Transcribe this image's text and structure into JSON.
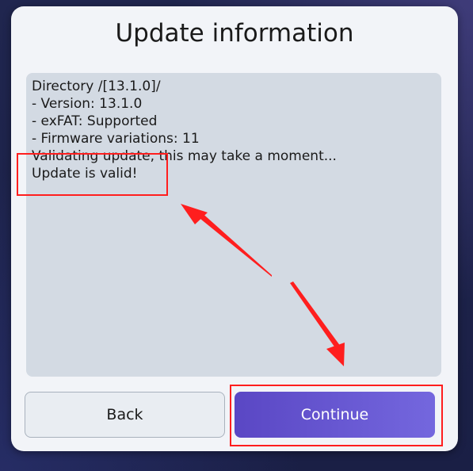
{
  "dialog": {
    "title": "Update information",
    "log_lines": [
      "Directory /[13.1.0]/",
      "- Version: 13.1.0",
      "- exFAT: Supported",
      "- Firmware variations: 11",
      "Validating update, this may take a moment...",
      "Update is valid!"
    ],
    "buttons": {
      "back_label": "Back",
      "continue_label": "Continue"
    }
  },
  "colors": {
    "background": "#1c2148",
    "dialog_bg": "#f2f4f8",
    "log_bg": "#d3dae3",
    "continue_start": "#5a47c4",
    "continue_end": "#7467de",
    "annotation": "#ff1e1e"
  }
}
